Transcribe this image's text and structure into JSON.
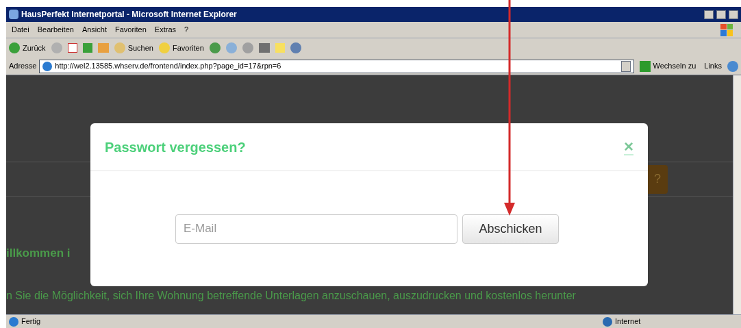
{
  "window": {
    "title": "HausPerfekt Internetportal - Microsoft Internet Explorer"
  },
  "menu": [
    "Datei",
    "Bearbeiten",
    "Ansicht",
    "Favoriten",
    "Extras",
    "?"
  ],
  "toolbar": {
    "back": "Zurück",
    "search": "Suchen",
    "favorites": "Favoriten"
  },
  "address_bar": {
    "label": "Adresse",
    "url": "http://wel2.13585.whserv.de/frontend/index.php?page_id=17&rpn=6",
    "go": "Wechseln zu",
    "links": "Links"
  },
  "page": {
    "header_button": "?",
    "heading": "illkommen i",
    "paragraph": "n Sie die Möglichkeit, sich Ihre Wohnung betreffende Unterlagen anzuschauen, auszudrucken und kostenlos herunter"
  },
  "dialog": {
    "title": "Passwort vergessen?",
    "close": "×",
    "email": {
      "placeholder": "E-Mail"
    },
    "submit": "Abschicken"
  },
  "status_bar": {
    "text": "Fertig",
    "zone": "Internet"
  }
}
